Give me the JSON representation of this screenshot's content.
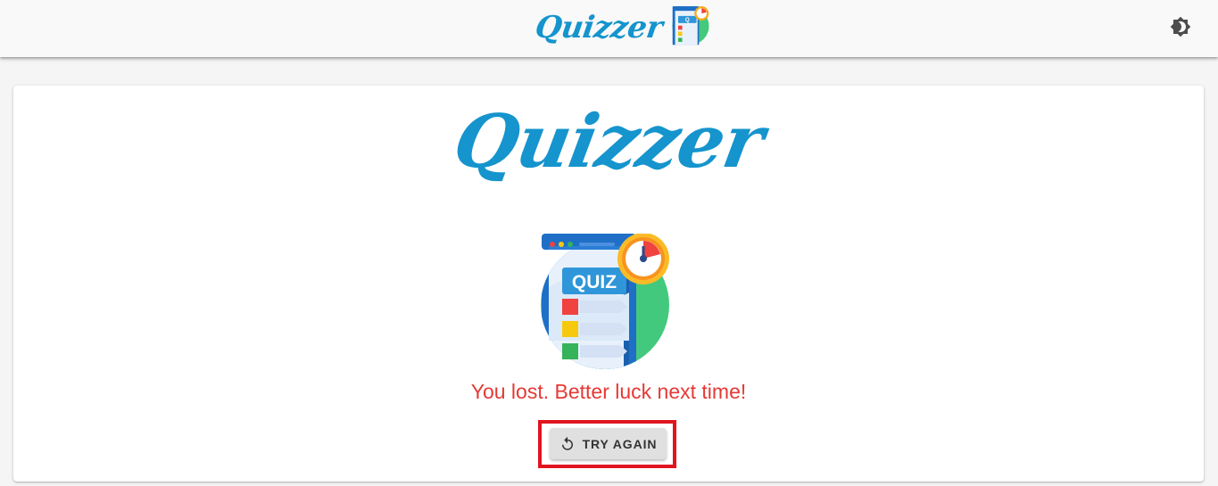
{
  "header": {
    "brand": "Quizzer",
    "theme_toggle_icon": "brightness-icon"
  },
  "main": {
    "brand": "Quizzer",
    "illustration": {
      "icon": "quiz-clipboard-icon",
      "badge_text": "QUIZ",
      "timer_icon": "stopwatch-icon"
    },
    "result_message": "You lost. Better luck next time!",
    "try_again": {
      "label": "TRY AGAIN",
      "icon": "replay-icon"
    }
  },
  "colors": {
    "brand": "#1594cd",
    "error": "#e53935",
    "highlight": "#e0141e",
    "button_bg": "#e0e0e0"
  }
}
